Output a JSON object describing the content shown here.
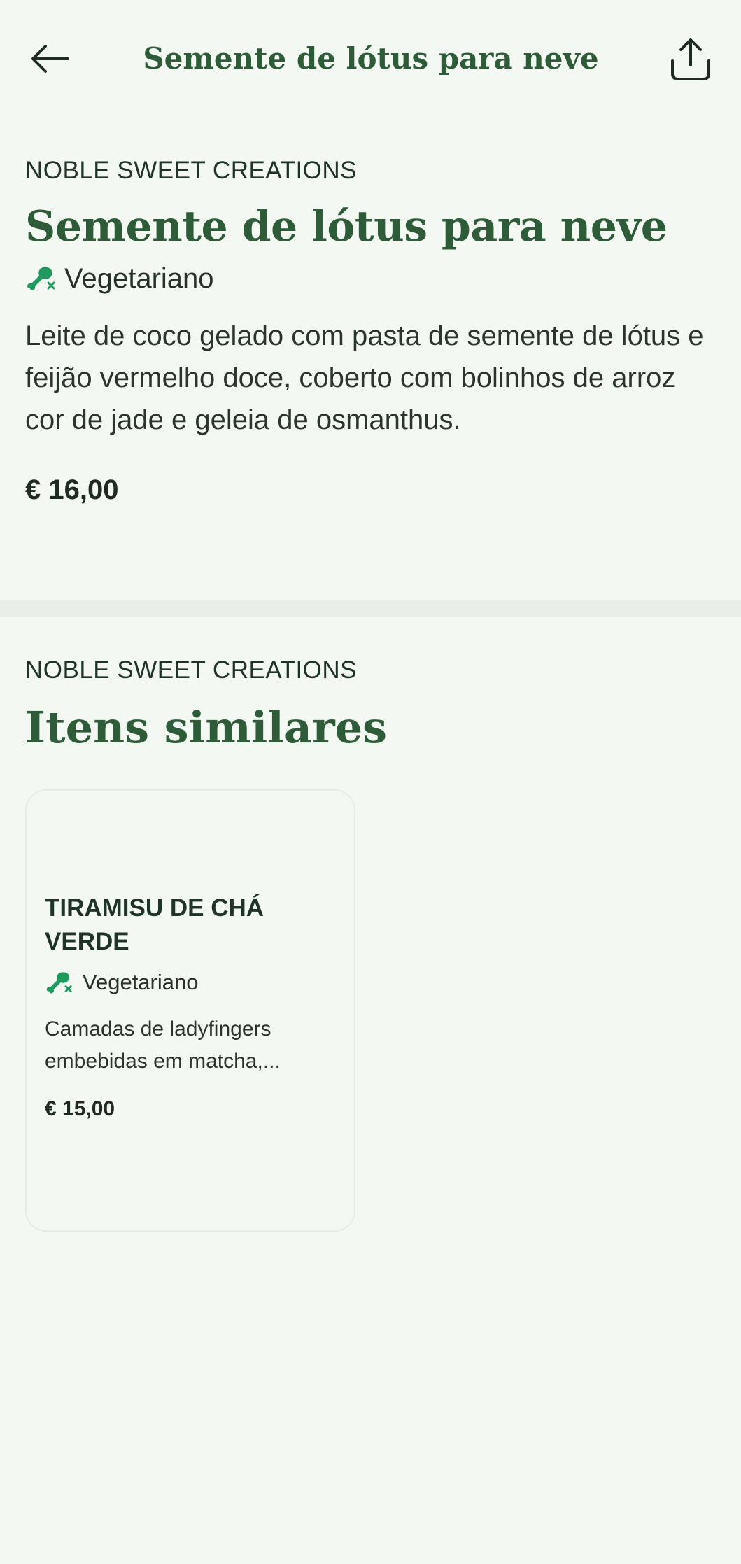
{
  "header": {
    "title": "Semente de lótus para neve",
    "back_icon": "arrow-left-icon",
    "share_icon": "share-icon"
  },
  "item": {
    "restaurant": "NOBLE SWEET CREATIONS",
    "title": "Semente de lótus para neve",
    "diet": "Vegetariano",
    "diet_icon": "no-meat-icon",
    "description": "Leite de coco gelado com pasta de semente de lótus e feijão vermelho doce, coberto com bolinhos de arroz cor de jade e geleia de osmanthus.",
    "price": "€ 16,00"
  },
  "similar": {
    "restaurant": "NOBLE SWEET CREATIONS",
    "title": "Itens similares",
    "items": [
      {
        "title": "TIRAMISU DE CHÁ VERDE",
        "diet": "Vegetariano",
        "description": "Camadas de ladyfingers embebidas em matcha,...",
        "price": "€ 15,00"
      }
    ]
  },
  "colors": {
    "background": "#f3f8f2",
    "heading_green": "#2e5c38",
    "diet_icon_green": "#1e9a5e"
  }
}
